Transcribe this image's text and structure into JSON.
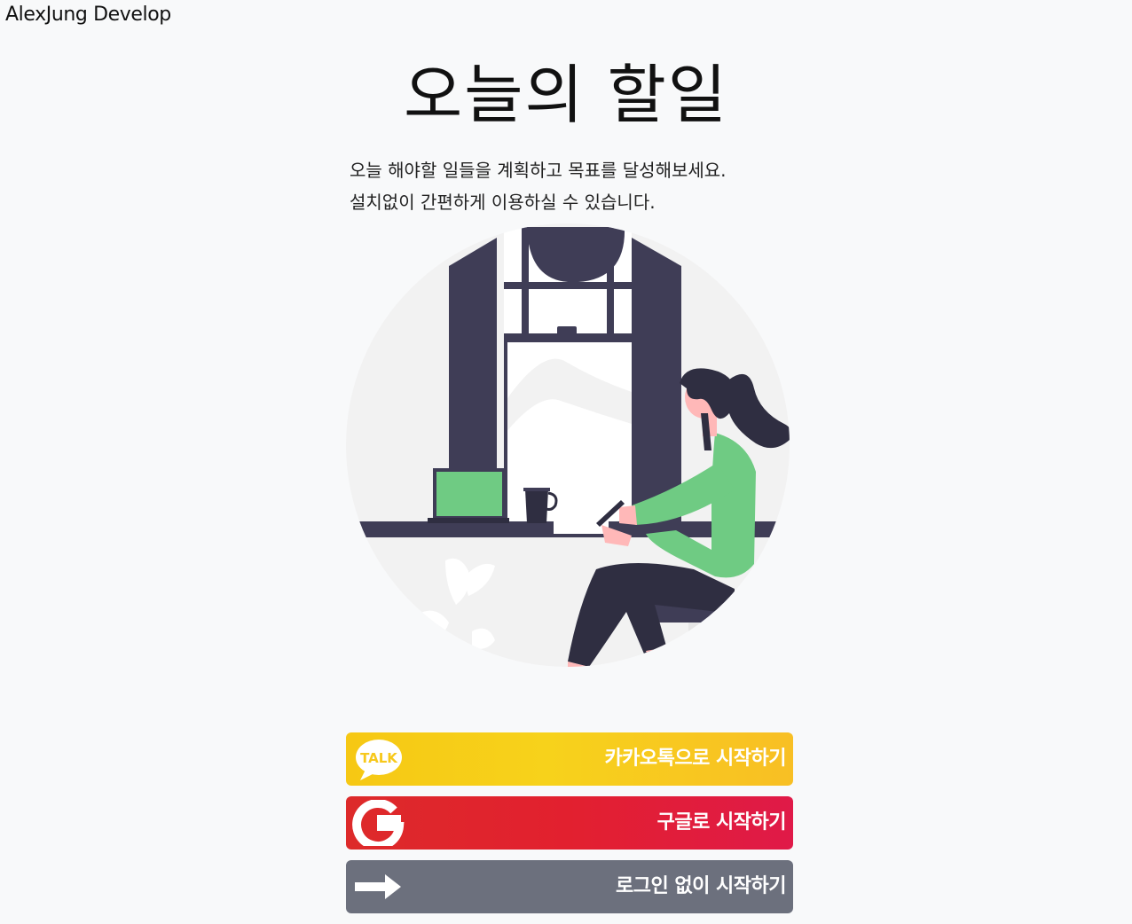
{
  "header": {
    "brand": "AlexJung Develop"
  },
  "hero": {
    "title": "오늘의 할일",
    "description_lines": [
      "오늘 해야할 일들을 계획하고 목표를 달성해보세요.",
      "설치없이 간편하게 이용하실 수 있습니다."
    ]
  },
  "login": {
    "kakao": {
      "label": "카카오톡으로 시작하기",
      "icon": "kakao-talk-icon",
      "icon_text": "TALK",
      "color": "#f7c81c"
    },
    "google": {
      "label": "구글로 시작하기",
      "icon": "google-g-icon",
      "color": "#e0252f"
    },
    "guest": {
      "label": "로그인 없이 시작하기",
      "icon": "arrow-right-icon",
      "color": "#6c707d"
    }
  },
  "colors": {
    "background": "#f8f9fa",
    "illustration_dark": "#3f3d56",
    "illustration_green": "#6fcb83",
    "illustration_skin": "#ffb8b8"
  }
}
